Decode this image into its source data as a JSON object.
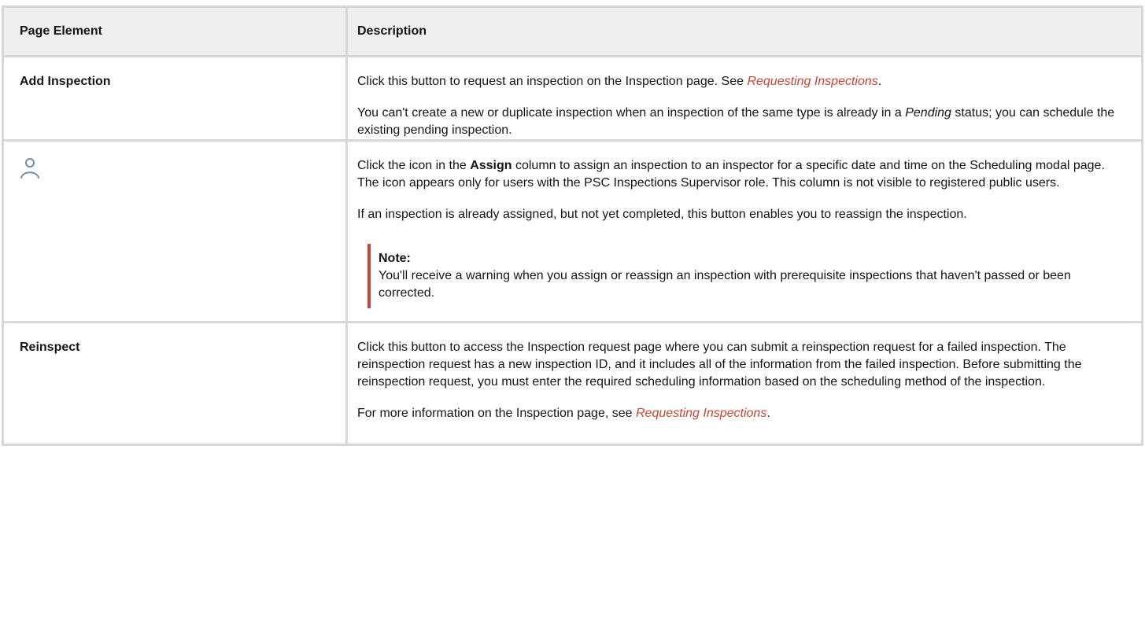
{
  "header": {
    "col1": "Page Element",
    "col2": "Description"
  },
  "rows": [
    {
      "element": "Add Inspection",
      "p1_before": "Click this button to request an inspection on the Inspection page. See ",
      "p1_link": "Requesting Inspections",
      "p1_after": ".",
      "p2_before": "You can't create a new or duplicate inspection when an inspection of the same type is already in a ",
      "p2_em": "Pending",
      "p2_after": " status; you can schedule the existing pending inspection."
    },
    {
      "element_icon": "user-icon",
      "p1_before": "Click the icon in the ",
      "p1_strong": "Assign",
      "p1_after": " column to assign an inspection to an inspector for a specific date and time on the Scheduling modal page. The icon appears only for users with the PSC Inspections Supervisor role. This column is not visible to registered public users.",
      "p2": "If an inspection is already assigned, but not yet completed, this button enables you to reassign the inspection.",
      "note_title": "Note:",
      "note_text": "You'll receive a warning when you assign or reassign an inspection with prerequisite inspections that haven't passed or been corrected."
    },
    {
      "element": "Reinspect",
      "p1": "Click this button to access the Inspection request page where you can submit a reinspection request for a failed inspection. The reinspection request has a new inspection ID, and it includes all of the information from the failed inspection. Before submitting the reinspection request, you must enter the required scheduling information based on the scheduling method of the inspection.",
      "p2_before": "For more information on the Inspection page, see ",
      "p2_link": "Requesting Inspections",
      "p2_after": "."
    }
  ],
  "colors": {
    "accent": "#c74634",
    "header_bg": "#f1efed",
    "border": "#d9d6d3",
    "icon": "#6f8fa6"
  }
}
